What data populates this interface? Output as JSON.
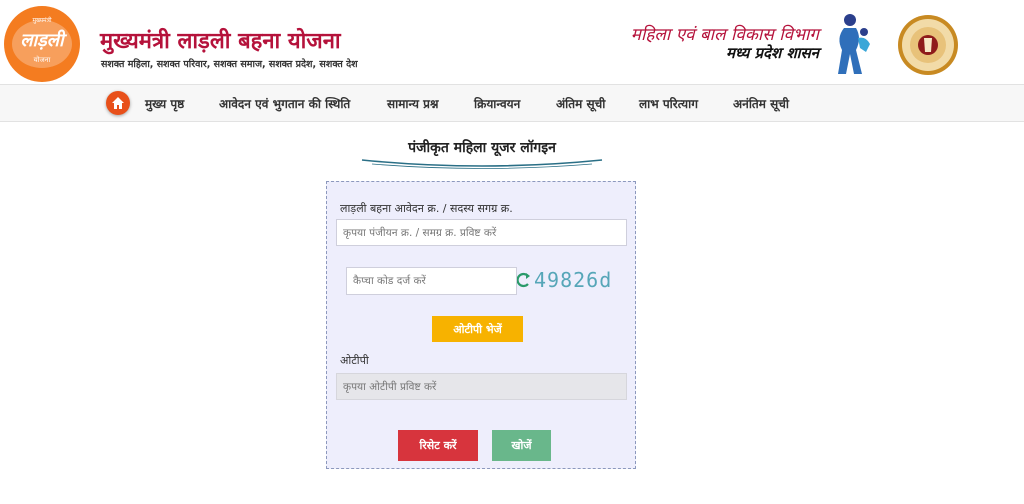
{
  "header": {
    "logo": {
      "line1": "मुख्यमंत्री",
      "line2": "लाड़ली",
      "line3": "योजना",
      "bg_color": "#f47c20"
    },
    "title": "मुख्यमंत्री लाड़ली बहना योजना",
    "tagline": "सशक्त महिला, सशक्त परिवार, सशक्त समाज, सशक्त प्रदेश, सशक्त देश",
    "department_line1": "महिला एवं बाल विकास विभाग",
    "department_line2": "मध्य प्रदेश शासन",
    "icons": [
      "woman-child-figure-icon",
      "mp-government-emblem-icon"
    ],
    "title_color": "#b5123b"
  },
  "nav": {
    "home_icon": "home-icon",
    "home_color": "#e8501a",
    "items": [
      "मुख्य पृष्ठ",
      "आवेदन एवं भुगतान की स्थिति",
      "सामान्य प्रश्न",
      "क्रियान्वयन",
      "अंतिम सूची",
      "लाभ परित्याग",
      "अनंतिम सूची"
    ]
  },
  "login": {
    "title": "पंजीकृत महिला यूजर लॉगइन",
    "application_label": "लाड़ली बहना आवेदन क्र. / सदस्य सगग्र क्र.",
    "application_placeholder": "कृपया पंजीयन क्र. / समग्र क्र. प्रविष्ट करें",
    "captcha_placeholder": "कैप्चा कोड दर्ज करें",
    "captcha_code": "49826d",
    "captcha_refresh_icon": "refresh-icon",
    "otp_button": "ओटीपी भेजें",
    "otp_label": "ओटीपी",
    "otp_placeholder": "कृपया ओटीपी प्रविष्ट करें",
    "reset_button": "रिसेट करें",
    "search_button": "खोजें"
  },
  "colors": {
    "form_bg": "#eeeefc",
    "otp_button": "#f7b200",
    "reset_button": "#d7343d",
    "search_button": "#69b78b"
  }
}
